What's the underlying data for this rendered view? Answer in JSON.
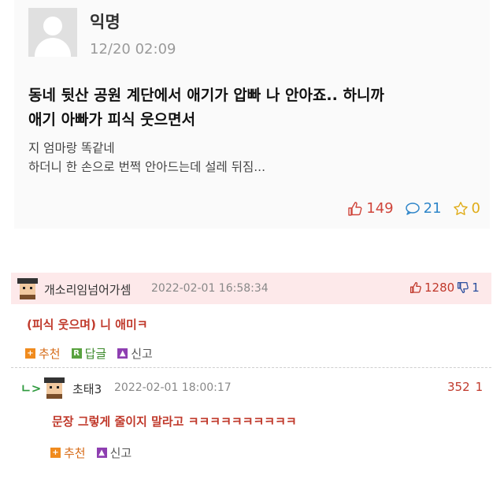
{
  "post": {
    "author": "익명",
    "timestamp": "12/20 02:09",
    "title_line1": "동네 뒷산 공원 계단에서 애기가 압빠 나 안아죠.. 하니까",
    "title_line2": "애기 아빠가 피식 웃으면서",
    "content_line1": "지 엄마랑 똑같네",
    "content_line2": "하더니 한 손으로 번쩍 안아드는데 설레 뒤짐...",
    "stats": {
      "votes": "149",
      "comments": "21",
      "scraps": "0"
    },
    "colors": {
      "vote": "#d0463c",
      "comment": "#2f86c9",
      "scrap": "#e0ac18"
    }
  },
  "comments": [
    {
      "nickname": "개소리임넘어가셈",
      "date": "2022-02-01 16:58:34",
      "upvotes": "1280",
      "downvotes": "1",
      "text": "(피식 웃으며) 니 애미ㅋ",
      "actions": {
        "recommend": "추천",
        "reply": "답글",
        "report": "신고"
      },
      "highlight_color": "#fde9ea"
    },
    {
      "reply_marker": "ㄴ>",
      "nickname": "초태3",
      "date": "2022-02-01 18:00:17",
      "upvotes": "352",
      "downvotes": "1",
      "text": "문장 그렇게 줄이지 말라고 ㅋㅋㅋㅋㅋㅋㅋㅋㅋㅋ",
      "actions": {
        "recommend": "추천",
        "report": "신고"
      }
    }
  ],
  "icons": {
    "post_avatar": "default-profile-icon",
    "vote": "thumbs-up-icon",
    "comment": "speech-bubble-icon",
    "scrap": "star-icon",
    "comment_avatar": "pixel-character-icon",
    "downvote": "thumbs-down-icon",
    "recommend": "plus-badge-icon",
    "reply": "reply-badge-icon",
    "report": "siren-badge-icon"
  }
}
